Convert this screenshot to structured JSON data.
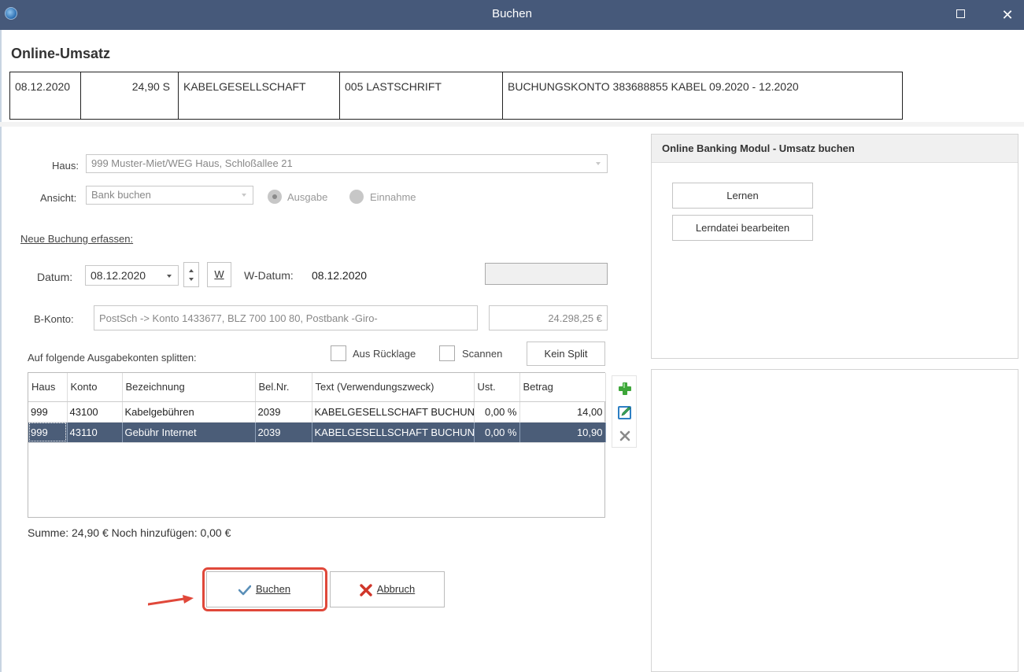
{
  "window": {
    "title": "Buchen",
    "maximize_icon": "maximize-icon",
    "close_label": "✕"
  },
  "umsatz": {
    "heading": "Online-Umsatz",
    "date": "08.12.2020",
    "amount": "24,90 S",
    "recipient": "KABELGESELLSCHAFT",
    "type": "005 LASTSCHRIFT",
    "purpose": "BUCHUNGSKONTO 383688855 KABEL 09.2020 - 12.2020"
  },
  "form": {
    "haus_label": "Haus:",
    "haus_value": "999 Muster-Miet/WEG Haus, Schloßallee 21",
    "ansicht_label": "Ansicht:",
    "ansicht_value": "Bank buchen",
    "radio_ausgabe": "Ausgabe",
    "radio_einnahme": "Einnahme",
    "selected_radio": "Ausgabe",
    "neue_buchung": "Neue Buchung erfassen:",
    "datum_label": "Datum:",
    "datum_value": "08.12.2020",
    "w_button": "W",
    "wdatum_label": "W-Datum:",
    "wdatum_value": "08.12.2020",
    "bkonto_label": "B-Konto:",
    "bkonto_value": "PostSch -> Konto 1433677, BLZ 700 100 80, Postbank -Giro-",
    "bkonto_balance": "24.298,25 €",
    "split_label": "Auf folgende Ausgabekonten splitten:",
    "aus_ruecklage": "Aus Rücklage",
    "scannen": "Scannen",
    "kein_split": "Kein Split"
  },
  "grid": {
    "columns": [
      "Haus",
      "Konto",
      "Bezeichnung",
      "Bel.Nr.",
      "Text (Verwendungszweck)",
      "Ust.",
      "Betrag"
    ],
    "rows": [
      [
        "999",
        "43100",
        "Kabelgebühren",
        "2039",
        "KABELGESELLSCHAFT BUCHUN",
        "0,00 %",
        "14,00"
      ],
      [
        "999",
        "43110",
        "Gebühr Internet",
        "2039",
        "KABELGESELLSCHAFT BUCHUN",
        "0,00 %",
        "10,90"
      ]
    ],
    "selected_row": 1,
    "tools": [
      "add-icon",
      "edit-icon",
      "delete-icon"
    ]
  },
  "summary": "Summe: 24,90 € Noch hinzufügen: 0,00 €",
  "actions": {
    "buchen": "Buchen",
    "abbruch": "Abbruch",
    "highlight_color": "#e0483a"
  },
  "right_panel": {
    "heading": "Online Banking Modul - Umsatz buchen",
    "lernen": "Lernen",
    "lerndatei": "Lerndatei bearbeiten"
  },
  "colors": {
    "titlebar": "#46597a",
    "selected_row": "#4b5d78"
  }
}
